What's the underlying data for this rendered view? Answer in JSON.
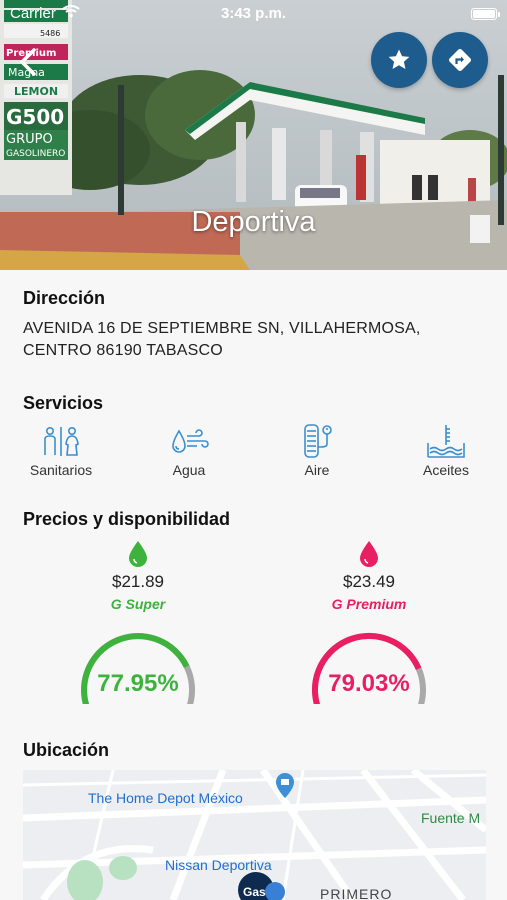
{
  "status_bar": {
    "carrier": "Carrier",
    "time": "3:43 p.m."
  },
  "hero": {
    "station_name": "Deportiva",
    "sign_texts": [
      "5486",
      "Premium",
      "Magna",
      "LEMON",
      "G500",
      "GRUPO",
      "GASOLINERO"
    ]
  },
  "address": {
    "title": "Dirección",
    "text": "AVENIDA 16 DE SEPTIEMBRE SN, VILLAHERMOSA, CENTRO 86190 TABASCO"
  },
  "services": {
    "title": "Servicios",
    "items": [
      {
        "label": "Sanitarios",
        "icon": "restroom-icon"
      },
      {
        "label": "Agua",
        "icon": "water-air-icon"
      },
      {
        "label": "Aire",
        "icon": "tire-pressure-icon"
      },
      {
        "label": "Aceites",
        "icon": "oil-level-icon"
      }
    ]
  },
  "prices": {
    "title": "Precios y disponibilidad",
    "fuels": [
      {
        "price": "$21.89",
        "brand": "Super",
        "availability": "77.95%",
        "availability_value": 77.95,
        "color": "#3db33d"
      },
      {
        "price": "$23.49",
        "brand": "Premium",
        "availability": "79.03%",
        "availability_value": 79.03,
        "color": "#e91e63"
      }
    ]
  },
  "location": {
    "title": "Ubicación",
    "map_labels": [
      "The Home Depot México",
      "Fuente M",
      "Nissan Deportiva",
      "PRIMERO"
    ],
    "marker_text": "Gas"
  },
  "colors": {
    "primary": "#1e5c8d",
    "accent_blue": "#3a8fd0",
    "super_green": "#3db33d",
    "premium_pink": "#e91e63",
    "gauge_gray": "#a9a9a9"
  }
}
